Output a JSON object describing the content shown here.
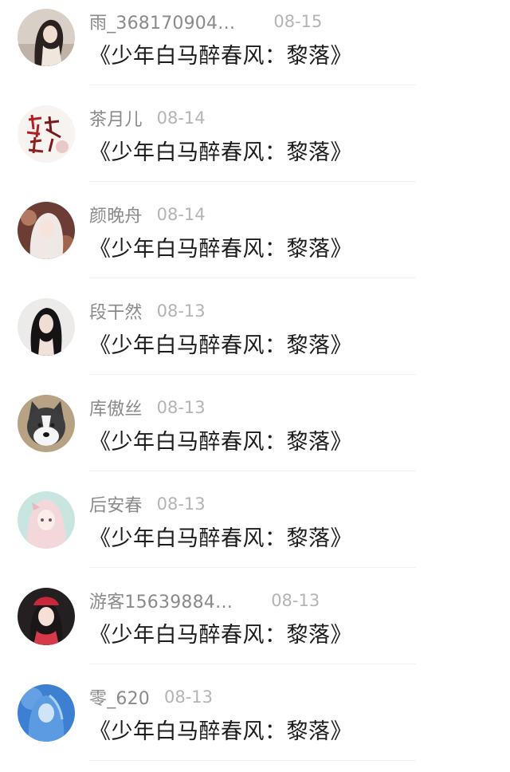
{
  "comments": [
    {
      "username": "雨_368170904…",
      "date": "08-15",
      "message": "《少年白马醉春风：黎落》",
      "avatar": "avatar-girl-dark-hair"
    },
    {
      "username": "茶月儿",
      "date": "08-14",
      "message": "《少年白马醉春风：黎落》",
      "avatar": "avatar-calligraphy"
    },
    {
      "username": "颜晚舟",
      "date": "08-14",
      "message": "《少年白马醉春风：黎落》",
      "avatar": "avatar-anime-white-hair"
    },
    {
      "username": "段干然",
      "date": "08-13",
      "message": "《少年白马醉春风：黎落》",
      "avatar": "avatar-girl-long-hair"
    },
    {
      "username": "库傲丝",
      "date": "08-13",
      "message": "《少年白马醉春风：黎落》",
      "avatar": "avatar-husky-dog"
    },
    {
      "username": "后安春",
      "date": "08-13",
      "message": "《少年白马醉春风：黎落》",
      "avatar": "avatar-anime-pink-hair"
    },
    {
      "username": "游客15639884…",
      "date": "08-13",
      "message": "《少年白马醉春风：黎落》",
      "avatar": "avatar-girl-red-hat"
    },
    {
      "username": "零_620",
      "date": "08-13",
      "message": "《少年白马醉春风：黎落》",
      "avatar": "avatar-blue-fantasy"
    }
  ]
}
